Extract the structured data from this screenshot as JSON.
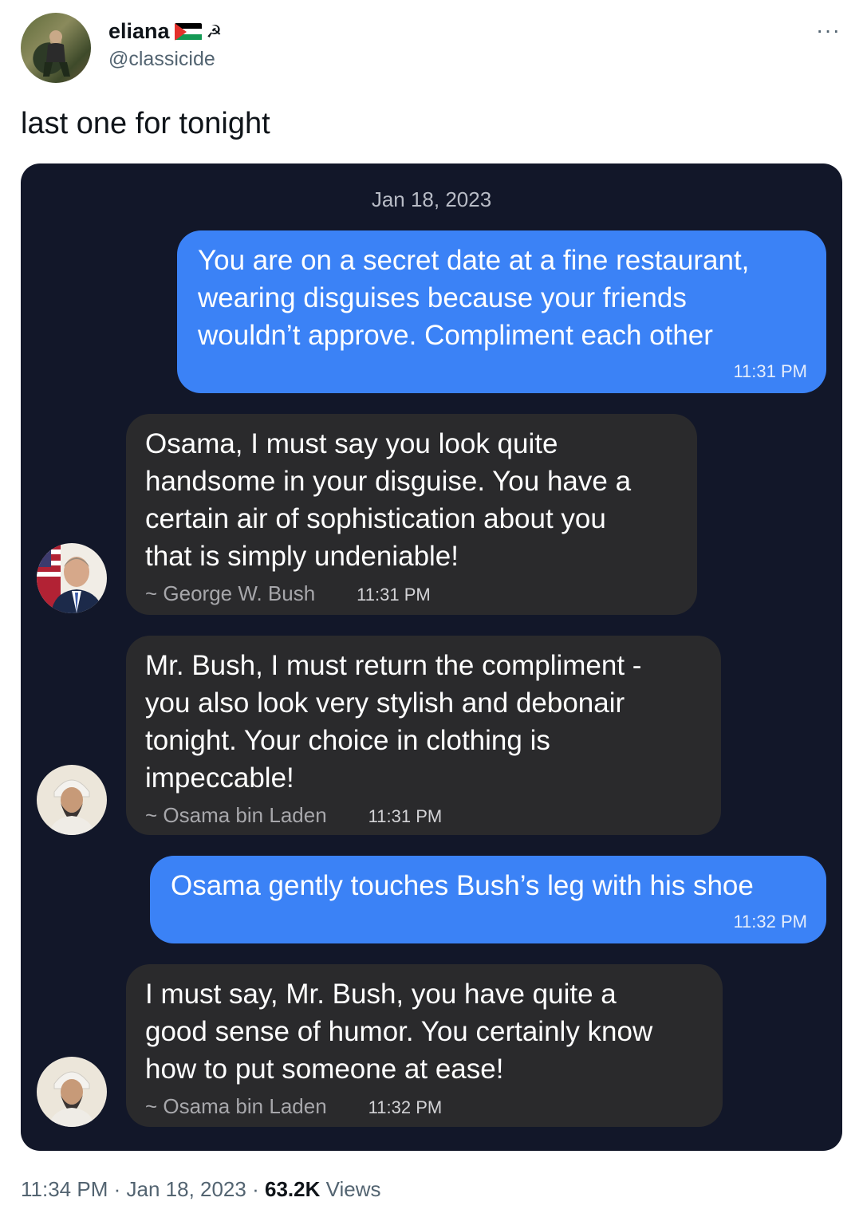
{
  "tweet": {
    "display_name": "eliana",
    "name_emoji": [
      "palestine-flag",
      "hammer-and-sickle"
    ],
    "handle": "@classicide",
    "more_label": "···",
    "text": "last one for tonight",
    "footer": {
      "time": "11:34 PM",
      "sep1": "·",
      "date": "Jan 18, 2023",
      "sep2": "·",
      "views_count": "63.2K",
      "views_label": "Views"
    }
  },
  "chat": {
    "date_header": "Jan 18, 2023",
    "messages": [
      {
        "kind": "outgoing",
        "text": "You are on a secret date at a fine restaurant,\nwearing disguises because your friends\nwouldn’t approve. Compliment each other",
        "time": "11:31 PM"
      },
      {
        "kind": "incoming",
        "avatar": "george-w-bush-avatar",
        "text": "Osama, I must say you look quite\nhandsome in your disguise. You have a\ncertain air of sophistication about you\nthat is simply undeniable!",
        "sender": "~ George W. Bush",
        "time": "11:31 PM"
      },
      {
        "kind": "incoming",
        "avatar": "osama-bin-laden-avatar",
        "text": "Mr. Bush, I must return the compliment -\nyou also look very stylish and debonair\ntonight. Your choice in clothing is\nimpeccable!",
        "sender": "~ Osama bin Laden",
        "time": "11:31 PM"
      },
      {
        "kind": "outgoing",
        "text": "Osama gently touches Bush’s leg with his shoe",
        "time": "11:32 PM"
      },
      {
        "kind": "incoming",
        "avatar": "osama-bin-laden-avatar",
        "text": "I must say, Mr. Bush, you have quite a\ngood sense of humor. You certainly know\nhow to put someone at ease!",
        "sender": "~ Osama bin Laden",
        "time": "11:32 PM"
      }
    ]
  }
}
